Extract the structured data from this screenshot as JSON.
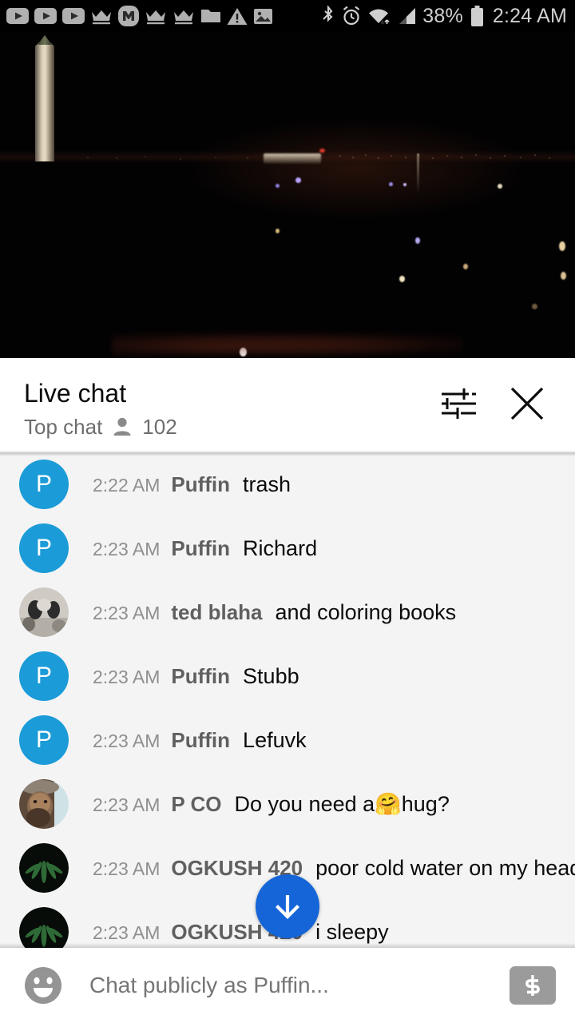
{
  "statusbar": {
    "left_icons": [
      "youtube-icon",
      "youtube-icon",
      "youtube-icon",
      "crown-icon",
      "m-badge-icon",
      "crown-icon",
      "crown-icon",
      "folder-icon",
      "warning-triangle-icon",
      "image-icon"
    ],
    "right_icons": [
      "bluetooth-icon",
      "alarm-icon",
      "wifi-icon",
      "signal-icon",
      "battery-icon"
    ],
    "battery_percent": "38%",
    "time": "2:24 AM"
  },
  "video": {
    "name": "live-video-player",
    "progress_color": "#e62117",
    "scene": "washington-monument-night"
  },
  "chat_header": {
    "title": "Live chat",
    "mode": "Top chat",
    "viewer_count": "102",
    "viewer_icon": "person-icon",
    "settings_icon": "tune-sliders-icon",
    "close_icon": "close-x-icon"
  },
  "messages": [
    {
      "time": "2:22 AM",
      "author": "Puffin",
      "text": "trash",
      "avatar_type": "letter",
      "avatar_letter": "P",
      "avatar_color": "#1b9bd8"
    },
    {
      "time": "2:23 AM",
      "author": "Puffin",
      "text": "Richard",
      "avatar_type": "letter",
      "avatar_letter": "P",
      "avatar_color": "#1b9bd8"
    },
    {
      "time": "2:23 AM",
      "author": "ted blaha",
      "text": "and coloring books",
      "avatar_type": "photo-dog",
      "avatar_letter": "",
      "avatar_color": "#c9c6bf"
    },
    {
      "time": "2:23 AM",
      "author": "Puffin",
      "text": "Stubb",
      "avatar_type": "letter",
      "avatar_letter": "P",
      "avatar_color": "#1b9bd8"
    },
    {
      "time": "2:23 AM",
      "author": "Puffin",
      "text": "Lefuvk",
      "avatar_type": "letter",
      "avatar_letter": "P",
      "avatar_color": "#1b9bd8"
    },
    {
      "time": "2:23 AM",
      "author": "P CO",
      "text": "Do you need a ",
      "text_after": "hug?",
      "emoji": "🤗",
      "avatar_type": "photo-man",
      "avatar_letter": "",
      "avatar_color": "#6b5c4c"
    },
    {
      "time": "2:23 AM",
      "author": "OGKUSH 420",
      "text": "poor cold water on my head",
      "avatar_type": "photo-leaf",
      "avatar_letter": "",
      "avatar_color": "#0b0f0b"
    },
    {
      "time": "2:23 AM",
      "author": "OGKUSH 420",
      "text": "i sleepy",
      "avatar_type": "photo-leaf",
      "avatar_letter": "",
      "avatar_color": "#0b0f0b"
    }
  ],
  "scroll_button": {
    "name": "scroll-to-bottom-button",
    "icon": "arrow-down-icon",
    "color": "#1565d8"
  },
  "input_bar": {
    "emoji_icon": "emoji-smiley-icon",
    "placeholder": "Chat publicly as Puffin...",
    "value": "",
    "superchat_icon": "dollar-superchat-icon"
  }
}
